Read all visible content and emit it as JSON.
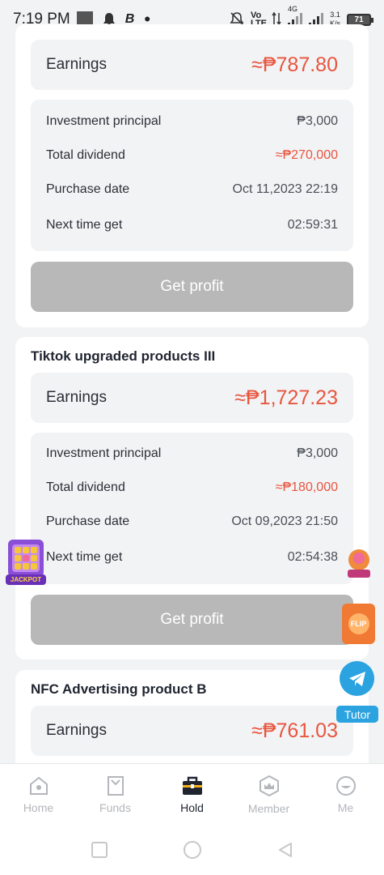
{
  "status_bar": {
    "time": "7:19 PM",
    "network_speed": "3.1",
    "speed_unit": "K/s",
    "battery": "71",
    "volte": "Vo LTE",
    "net_4g": "4G"
  },
  "cards": [
    {
      "earnings_label": "Earnings",
      "earnings_value": "≈₱787.80",
      "rows": [
        {
          "label": "Investment principal",
          "value": "₱3,000"
        },
        {
          "label": "Total dividend",
          "value": "≈₱270,000"
        },
        {
          "label": "Purchase date",
          "value": "Oct 11,2023 22:19"
        },
        {
          "label": "Next time get",
          "value": "02:59:31"
        }
      ],
      "button_label": "Get profit"
    },
    {
      "title": "Tiktok upgraded products III",
      "earnings_label": "Earnings",
      "earnings_value": "≈₱1,727.23",
      "rows": [
        {
          "label": "Investment principal",
          "value": "₱3,000"
        },
        {
          "label": "Total dividend",
          "value": "≈₱180,000"
        },
        {
          "label": "Purchase date",
          "value": "Oct 09,2023 21:50"
        },
        {
          "label": "Next time get",
          "value": "02:54:38"
        }
      ],
      "button_label": "Get profit"
    },
    {
      "title": "NFC Advertising product B",
      "earnings_label": "Earnings",
      "earnings_value": "≈₱761.03"
    }
  ],
  "floats": {
    "jackpot_label": "JACKPOT",
    "flip_label": "FLIP",
    "tutor_label": "Tutor"
  },
  "nav": {
    "items": [
      {
        "label": "Home"
      },
      {
        "label": "Funds"
      },
      {
        "label": "Hold"
      },
      {
        "label": "Member"
      },
      {
        "label": "Me"
      }
    ],
    "active": "Hold"
  },
  "colors": {
    "accent_red": "#e8553e",
    "disabled_button": "#b8b8b8",
    "telegram_blue": "#2aa3e0"
  }
}
